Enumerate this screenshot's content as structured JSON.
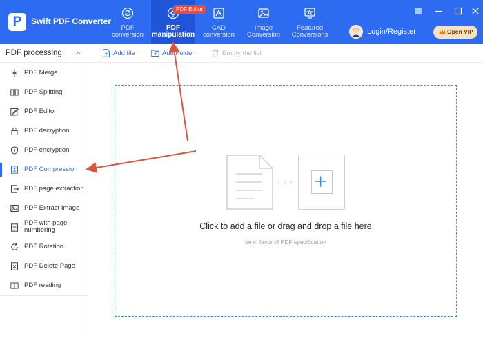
{
  "header": {
    "app_name": "Swift PDF Converter",
    "logo_letter": "P",
    "tabs": [
      {
        "label": "PDF\nconversion",
        "icon": "refresh-doc-icon"
      },
      {
        "label": "PDF\nmanipulation",
        "icon": "gear-doc-icon",
        "active": true
      },
      {
        "label": "CAD\nconversion",
        "icon": "cad-icon"
      },
      {
        "label": "Image\nConversion",
        "icon": "image-icon"
      },
      {
        "label": "Featured\nConversions",
        "icon": "star-monitor-icon"
      }
    ],
    "badge": "PDF Editor",
    "login": "Login/Register",
    "vip": "Open VIP"
  },
  "sidebar": {
    "section_title": "PDF processing",
    "items": [
      {
        "label": "PDF Merge",
        "icon": "merge-icon"
      },
      {
        "label": "PDF Splitting",
        "icon": "split-icon"
      },
      {
        "label": "PDF Editor",
        "icon": "edit-icon"
      },
      {
        "label": "PDF decryption",
        "icon": "unlock-icon"
      },
      {
        "label": "PDF encryption",
        "icon": "shield-icon"
      },
      {
        "label": "PDF Compression",
        "icon": "compress-icon",
        "active": true
      },
      {
        "label": "PDF page extraction",
        "icon": "extract-icon"
      },
      {
        "label": "PDF Extract Image",
        "icon": "image-icon"
      },
      {
        "label": "PDF with page numbering",
        "icon": "numbering-icon"
      },
      {
        "label": "PDF Rotation",
        "icon": "rotate-icon"
      },
      {
        "label": "PDF Delete Page",
        "icon": "delete-page-icon"
      },
      {
        "label": "PDF reading",
        "icon": "book-icon"
      }
    ]
  },
  "toolbar": {
    "add_file": "Add file",
    "add_folder": "Add Folder",
    "empty_list": "Empty the list"
  },
  "dropzone": {
    "main_text": "Click to add a file or drag and drop a file here",
    "sub_text": "be in favor of PDF specification",
    "arrows": "› › ›"
  },
  "colors": {
    "primary": "#2d6cf0",
    "active_tab": "#1f55d6",
    "badge": "#f04a3a",
    "vip_bg": "#fbe2bd",
    "annotation": "#e0533b"
  }
}
